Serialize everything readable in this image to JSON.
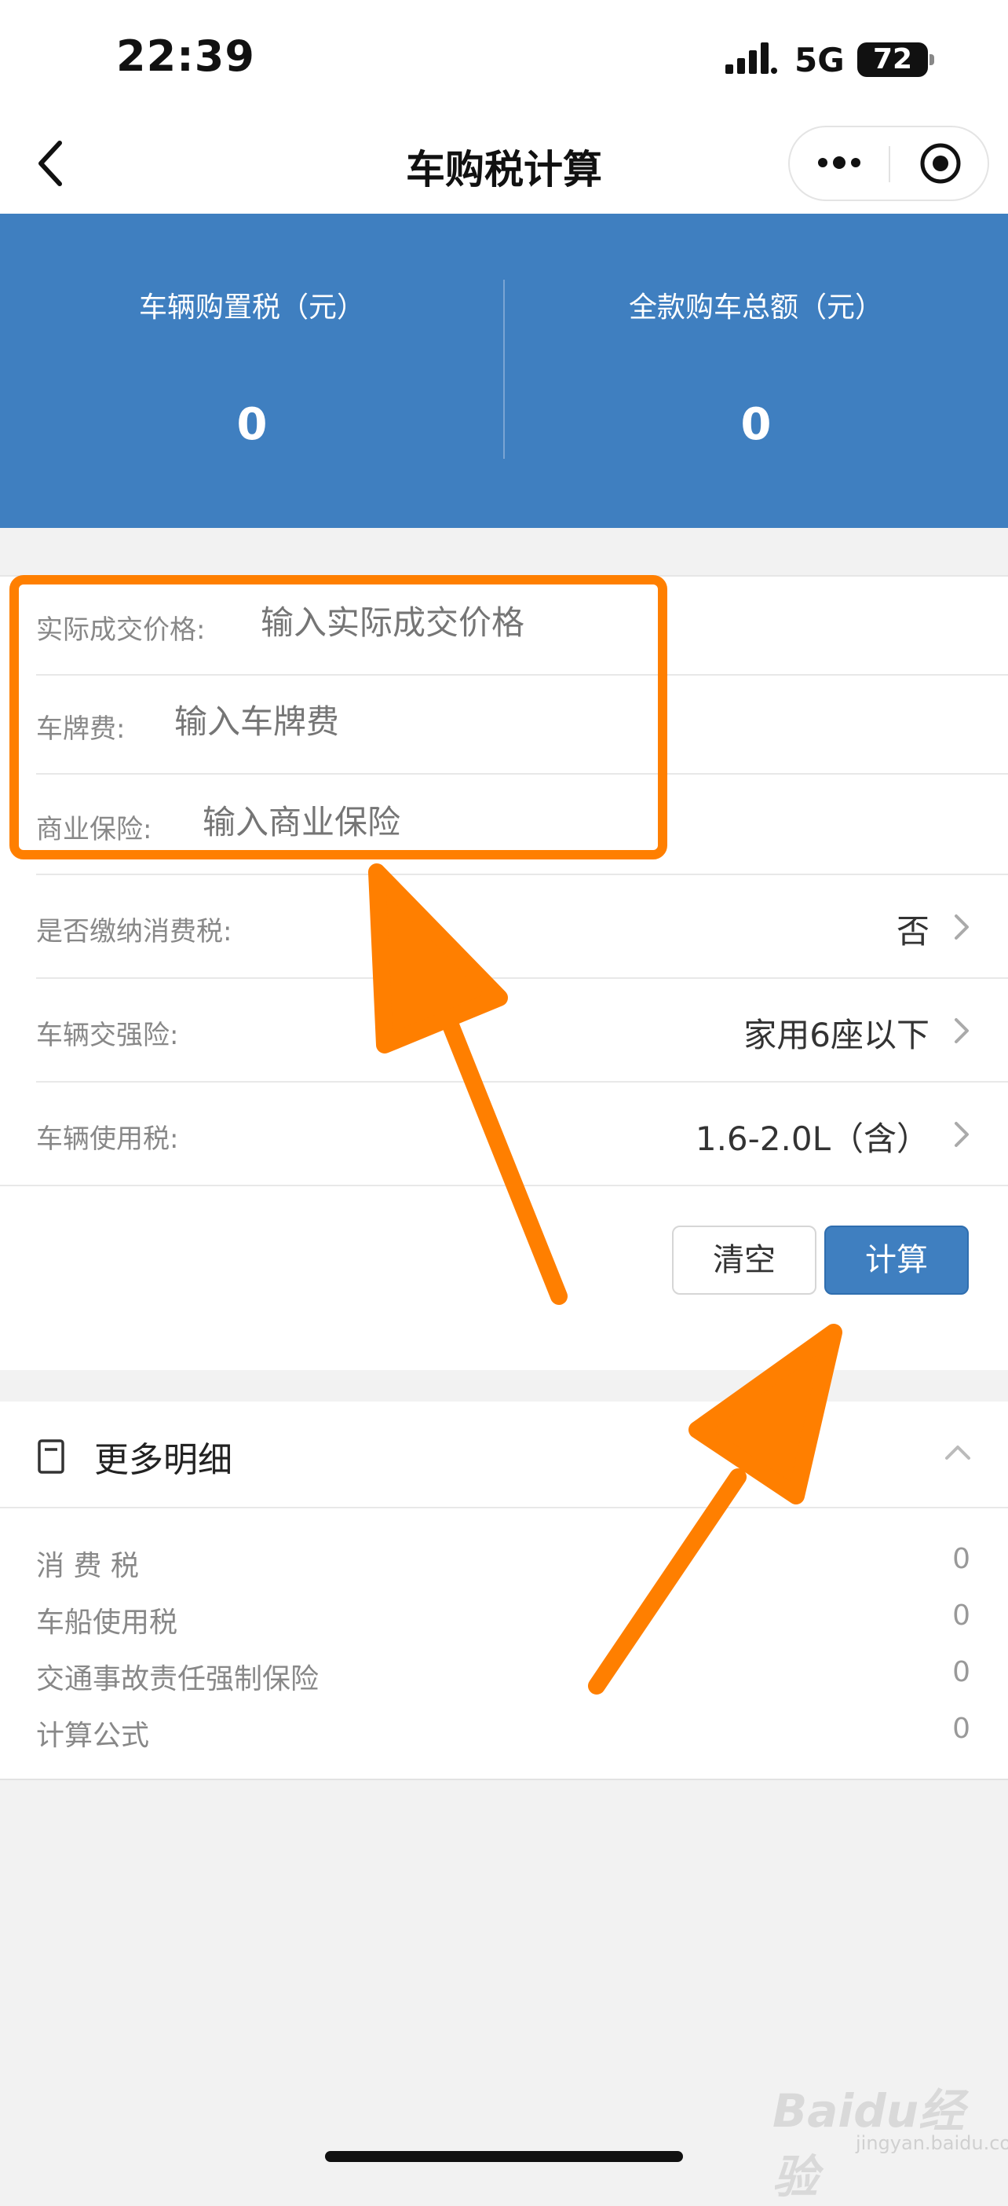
{
  "status_bar": {
    "time": "22:39",
    "network": "5G",
    "battery": "72"
  },
  "nav": {
    "title": "车购税计算"
  },
  "summary": {
    "left": {
      "label": "车辆购置税（元）",
      "value": "0"
    },
    "right": {
      "label": "全款购车总额（元）",
      "value": "0"
    }
  },
  "form": {
    "price": {
      "label": "实际成交价格:",
      "placeholder": "输入实际成交价格"
    },
    "plate": {
      "label": "车牌费:",
      "placeholder": "输入车牌费"
    },
    "insurance": {
      "label": "商业保险:",
      "placeholder": "输入商业保险"
    },
    "consumption_tax": {
      "label": "是否缴纳消费税:",
      "value": "否"
    },
    "compulsory": {
      "label": "车辆交强险:",
      "value": "家用6座以下"
    },
    "usage_tax": {
      "label": "车辆使用税:",
      "value": "1.6-2.0L（含）"
    }
  },
  "buttons": {
    "clear": "清空",
    "calculate": "计算"
  },
  "details": {
    "title": "更多明细",
    "items": [
      {
        "label": "消 费 税",
        "value": "0"
      },
      {
        "label": "车船使用税",
        "value": "0"
      },
      {
        "label": "交通事故责任强制保险",
        "value": "0"
      },
      {
        "label": "计算公式",
        "value": "0"
      }
    ]
  },
  "watermark": {
    "brand": "Baidu经验",
    "url": "jingyan.baidu.com"
  },
  "colors": {
    "accent_blue": "#3f7fc0",
    "annotation_orange": "#ff7f00"
  },
  "icons": [
    "signal-icon",
    "battery-icon",
    "back-icon",
    "more-dots-icon",
    "target-icon",
    "chevron-right-icon",
    "document-icon",
    "chevron-up-icon"
  ]
}
